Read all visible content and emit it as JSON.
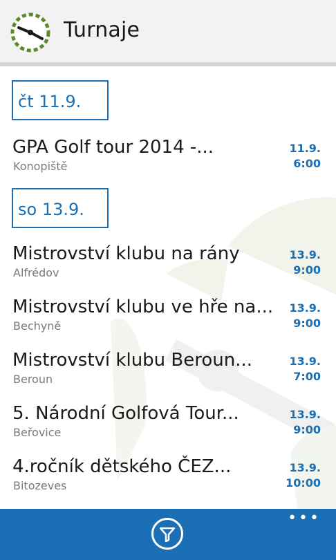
{
  "header": {
    "title": "Turnaje",
    "logo_icon": "golf-clock-icon"
  },
  "dates": [
    {
      "label": "čt 11.9."
    },
    {
      "label": "so 13.9."
    }
  ],
  "events": [
    {
      "title": "GPA Golf tour 2014 -...",
      "place": "Konopiště",
      "date": "11.9.",
      "time": "6:00"
    },
    {
      "title": "Mistrovství klubu na rány",
      "place": "Alfrédov",
      "date": "13.9.",
      "time": "9:00"
    },
    {
      "title": "Mistrovství klubu ve hře na...",
      "place": "Bechyně",
      "date": "13.9.",
      "time": "9:00"
    },
    {
      "title": "Mistrovství klubu Beroun...",
      "place": "Beroun",
      "date": "13.9.",
      "time": "7:00"
    },
    {
      "title": "5. Národní Golfová Tour...",
      "place": "Beřovice",
      "date": "13.9.",
      "time": "9:00"
    },
    {
      "title": "4.ročník dětského ČEZ...",
      "place": "Bitozeves",
      "date": "13.9.",
      "time": "10:00"
    }
  ],
  "appbar": {
    "filter_icon": "filter-icon",
    "more_label": "•••"
  },
  "colors": {
    "accent": "#1a6fb5",
    "logo_green": "#5a8a2a",
    "background_art": "#eef2e4"
  }
}
